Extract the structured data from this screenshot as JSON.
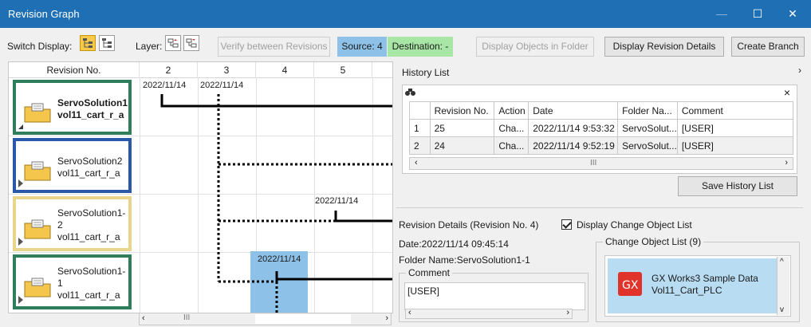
{
  "window": {
    "title": "Revision Graph",
    "minimize": "—",
    "maximize": "☐",
    "close": "✕"
  },
  "toolbar": {
    "switch_display_label": "Switch Display:",
    "layer_label": "Layer:",
    "verify_label": "Verify between Revisions",
    "source_label": "Source: 4",
    "destination_label": "Destination: -",
    "display_objects_label": "Display Objects in Folder",
    "display_details_label": "Display Revision Details",
    "create_branch_label": "Create Branch"
  },
  "graph": {
    "header_revision": "Revision No.",
    "columns": [
      "2",
      "3",
      "4",
      "5"
    ],
    "rows": [
      {
        "name": "ServoSolution1\nvol11_cart_r_a",
        "bold": true,
        "border": "#2e7d5b"
      },
      {
        "name": "ServoSolution2\nvol11_cart_r_a",
        "bold": false,
        "border": "#2b57a8"
      },
      {
        "name": "ServoSolution1-\n2\nvol11_cart_r_a",
        "bold": false,
        "border": "#e8d48a"
      },
      {
        "name": "ServoSolution1-\n1\nvol11_cart_r_a",
        "bold": false,
        "border": "#2e7d5b"
      }
    ],
    "dates": [
      "2022/11/14",
      "2022/11/14",
      "2022/11/14",
      "2022/11/14"
    ],
    "highlight_color": "#8ec1e8"
  },
  "history": {
    "title": "History List",
    "search_icon": "binoculars-icon",
    "close_label": "×",
    "columns": [
      "Revision No.",
      "Action",
      "Date",
      "Folder Na...",
      "Comment"
    ],
    "rows": [
      [
        "1",
        "25",
        "Cha...",
        "2022/11/14 9:53:32",
        "ServoSolut...",
        "[USER]"
      ],
      [
        "2",
        "24",
        "Cha...",
        "2022/11/14 9:52:19",
        "ServoSolut...",
        "[USER]"
      ]
    ],
    "save_label": "Save History List"
  },
  "details": {
    "title": "Revision Details (Revision No. 4)",
    "display_change_label": "Display Change Object List",
    "date_text": "Date:2022/11/14 09:45:14",
    "folder_text": "Folder Name:ServoSolution1-1",
    "comment_label": "Comment",
    "comment_value": "[USER]",
    "change_list_title": "Change Object List (9)",
    "change_item_line1": "GX Works3 Sample Data",
    "change_item_line2": "Vol11_Cart_PLC"
  }
}
